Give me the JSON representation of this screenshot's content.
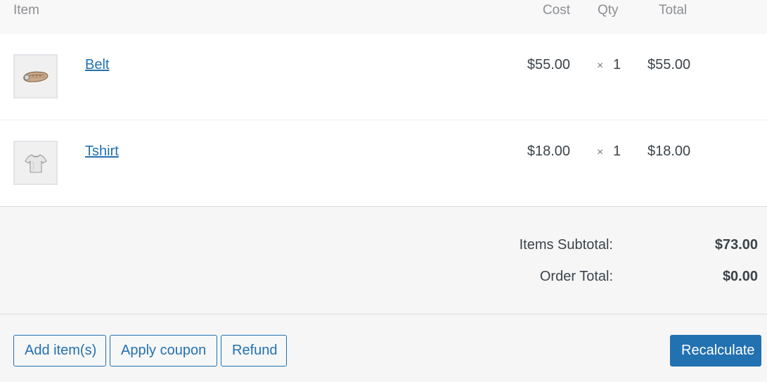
{
  "header": {
    "item": "Item",
    "cost": "Cost",
    "qty": "Qty",
    "total": "Total"
  },
  "items": [
    {
      "name": "Belt",
      "cost": "$55.00",
      "times": "×",
      "qty": "1",
      "total": "$55.00",
      "thumbnail_icon": "belt-icon"
    },
    {
      "name": "Tshirt",
      "cost": "$18.00",
      "times": "×",
      "qty": "1",
      "total": "$18.00",
      "thumbnail_icon": "tshirt-icon"
    }
  ],
  "totals": {
    "subtotal_label": "Items Subtotal:",
    "subtotal_value": "$73.00",
    "order_total_label": "Order Total:",
    "order_total_value": "$0.00"
  },
  "actions": {
    "add_items": "Add item(s)",
    "apply_coupon": "Apply coupon",
    "refund": "Refund",
    "recalculate": "Recalculate"
  },
  "colors": {
    "accent": "#2271b1",
    "header_bg": "#f8f8f8",
    "footer_bg": "#f6f6f6",
    "text": "#3c434a",
    "muted": "#8c8f94"
  }
}
